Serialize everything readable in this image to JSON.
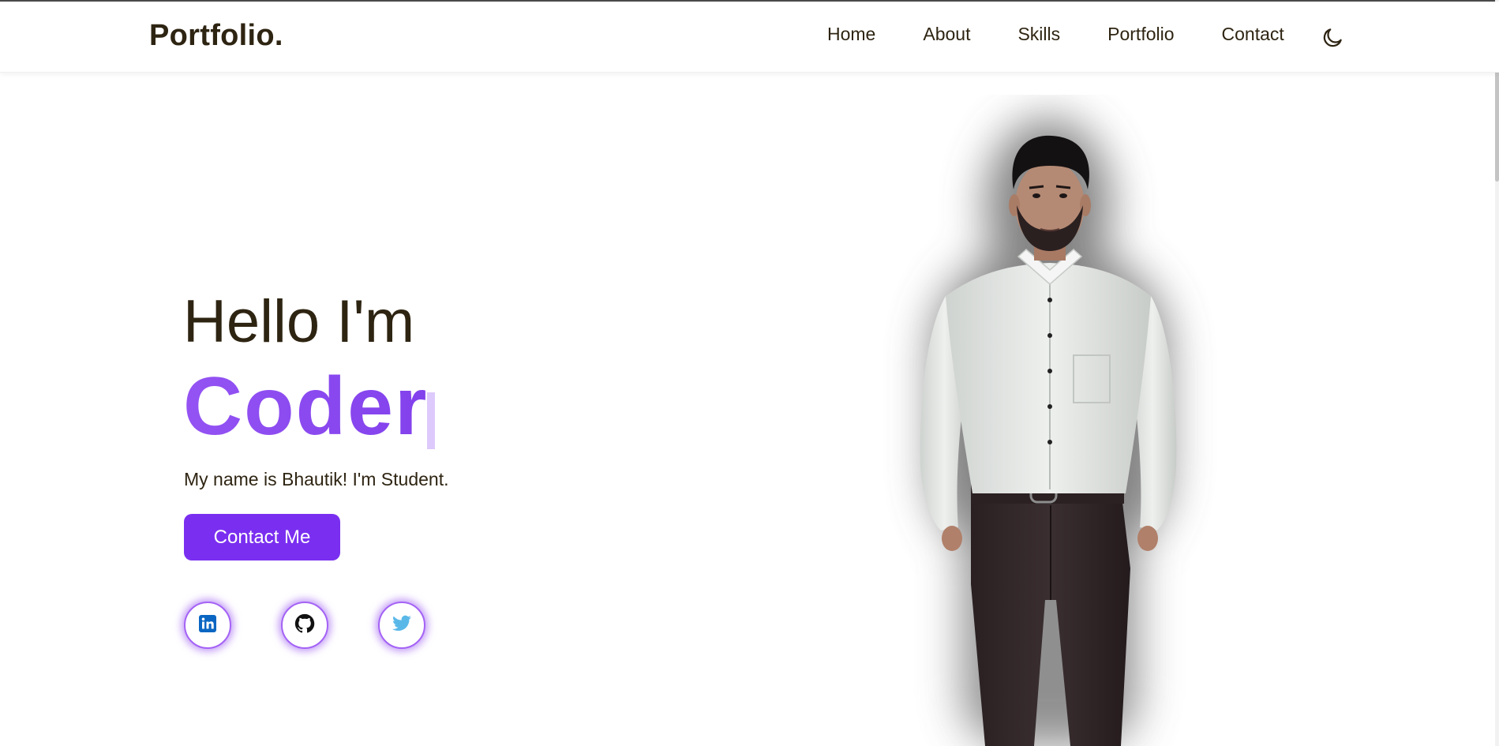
{
  "header": {
    "logo": "Portfolio.",
    "nav": [
      "Home",
      "About",
      "Skills",
      "Portfolio",
      "Contact"
    ],
    "theme_icon": "moon-icon"
  },
  "hero": {
    "greeting": "Hello I'm",
    "role": "Coder",
    "description": "My name is Bhautik! I'm Student.",
    "cta_label": "Contact Me"
  },
  "socials": [
    {
      "name": "linkedin",
      "icon": "linkedin-icon",
      "color": "#0a66c2"
    },
    {
      "name": "github",
      "icon": "github-icon",
      "color": "#111111"
    },
    {
      "name": "twitter",
      "icon": "twitter-icon",
      "color": "#5ab8e8"
    }
  ],
  "colors": {
    "accent": "#7a2ff0",
    "text": "#2e2412",
    "glow": "#a463f5"
  }
}
